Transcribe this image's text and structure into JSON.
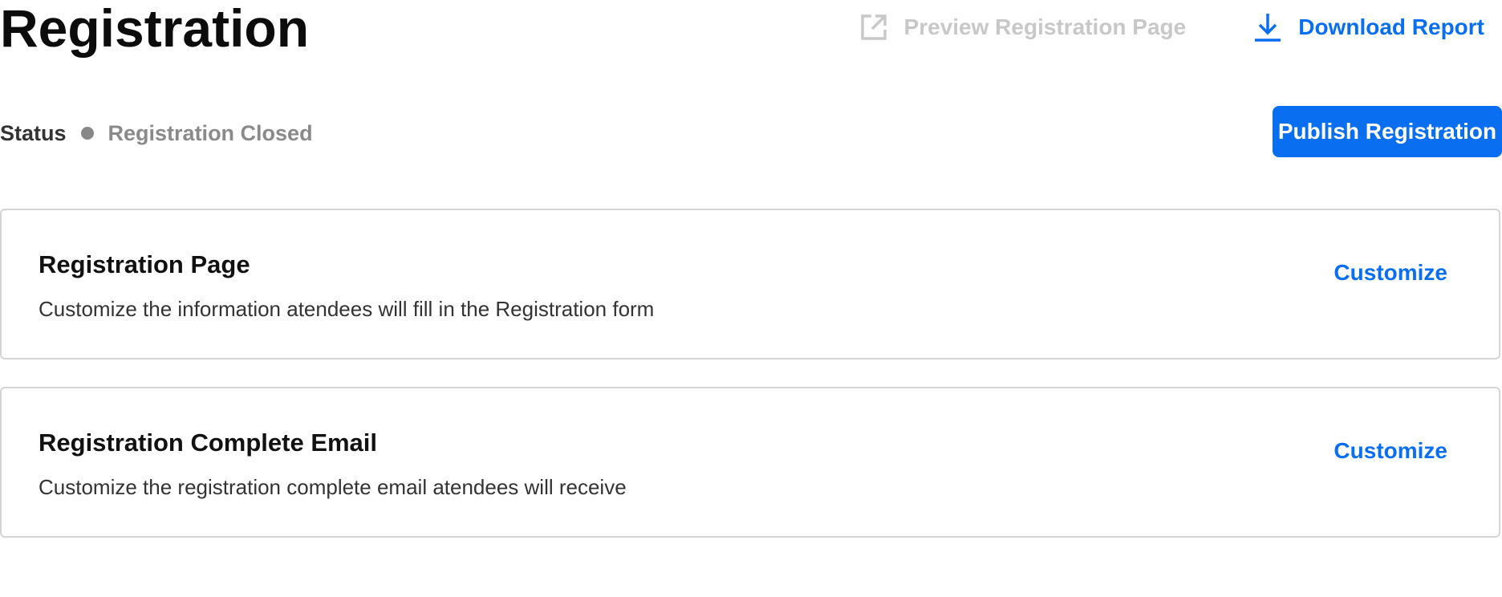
{
  "page": {
    "title": "Registration"
  },
  "header": {
    "preview_label": "Preview Registration Page",
    "preview_icon": "external-link-icon",
    "download_label": "Download Report",
    "download_icon": "download-icon"
  },
  "status": {
    "label": "Status",
    "value": "Registration Closed",
    "dot_color": "#888888"
  },
  "publish_button": {
    "label": "Publish Registration"
  },
  "cards": [
    {
      "title": "Registration Page",
      "description": "Customize the information atendees will fill in the Registration form",
      "action": "Customize"
    },
    {
      "title": "Registration Complete Email",
      "description": "Customize the registration complete email atendees will receive",
      "action": "Customize"
    }
  ],
  "colors": {
    "accent": "#0a6ef0",
    "disabled": "#c8c8c8",
    "muted": "#8a8a8a",
    "border": "#d4d4d4"
  }
}
